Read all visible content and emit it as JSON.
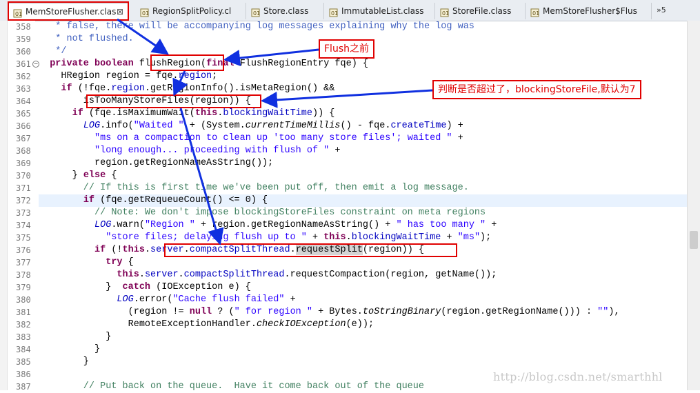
{
  "tabs": [
    {
      "label": "MemStoreFlusher.clas",
      "active": true
    },
    {
      "label": "RegionSplitPolicy.cl",
      "active": false
    },
    {
      "label": "Store.class",
      "active": false
    },
    {
      "label": "ImmutableList.class",
      "active": false
    },
    {
      "label": "StoreFile.class",
      "active": false
    },
    {
      "label": "MemStoreFlusher$Flus",
      "active": false
    }
  ],
  "tab_overflow": "»5",
  "line_numbers": [
    "358",
    "359",
    "360",
    "361",
    "362",
    "363",
    "364",
    "365",
    "366",
    "367",
    "368",
    "369",
    "370",
    "371",
    "372",
    "373",
    "374",
    "375",
    "376",
    "377",
    "378",
    "379",
    "380",
    "381",
    "382",
    "383",
    "384",
    "385",
    "386",
    "387"
  ],
  "code_lines": [
    "   * false, there will be accompanying log messages explaining why the log was",
    "   * not flushed.",
    "   */",
    "  private boolean flushRegion(final FlushRegionEntry fqe) {",
    "    HRegion region = fqe.region;",
    "    if (!fqe.region.getRegionInfo().isMetaRegion() &&",
    "        isTooManyStoreFiles(region)) {",
    "      if (fqe.isMaximumWait(this.blockingWaitTime)) {",
    "        LOG.info(\"Waited \" + (System.currentTimeMillis() - fqe.createTime) +",
    "          \"ms on a compaction to clean up 'too many store files'; waited \" +",
    "          \"long enough... proceeding with flush of \" +",
    "          region.getRegionNameAsString());",
    "      } else {",
    "        // If this is first time we've been put off, then emit a log message.",
    "        if (fqe.getRequeueCount() <= 0) {",
    "          // Note: We don't impose blockingStoreFiles constraint on meta regions",
    "          LOG.warn(\"Region \" + region.getRegionNameAsString() + \" has too many \" +",
    "            \"store files; delaying flush up to \" + this.blockingWaitTime + \"ms\");",
    "          if (!this.server.compactSplitThread.requestSplit(region)) {",
    "            try {",
    "              this.server.compactSplitThread.requestCompaction(region, getName());",
    "            }  catch (IOException e) {",
    "              LOG.error(\"Cache flush failed\" +",
    "                (region != null ? (\" for region \" + Bytes.toStringBinary(region.getRegionName())) : \"\"),",
    "                RemoteExceptionHandler.checkIOException(e));",
    "            }",
    "          }",
    "        }",
    "",
    "        // Put back on the queue.  Have it come back out of the queue"
  ],
  "annotations": {
    "flush_before": "Flush之前",
    "check_exceeded": "判断是否超过了，blockingStoreFile,默认为7"
  },
  "watermark": "http://blog.csdn.net/smarthhl",
  "colors": {
    "keyword": "#7f0055",
    "comment": "#3f7f5f",
    "javadoc": "#3f5fbf",
    "string": "#2a00ff",
    "field": "#0000c0",
    "annotation_red": "#e00000",
    "arrow_blue": "#1030e0"
  }
}
